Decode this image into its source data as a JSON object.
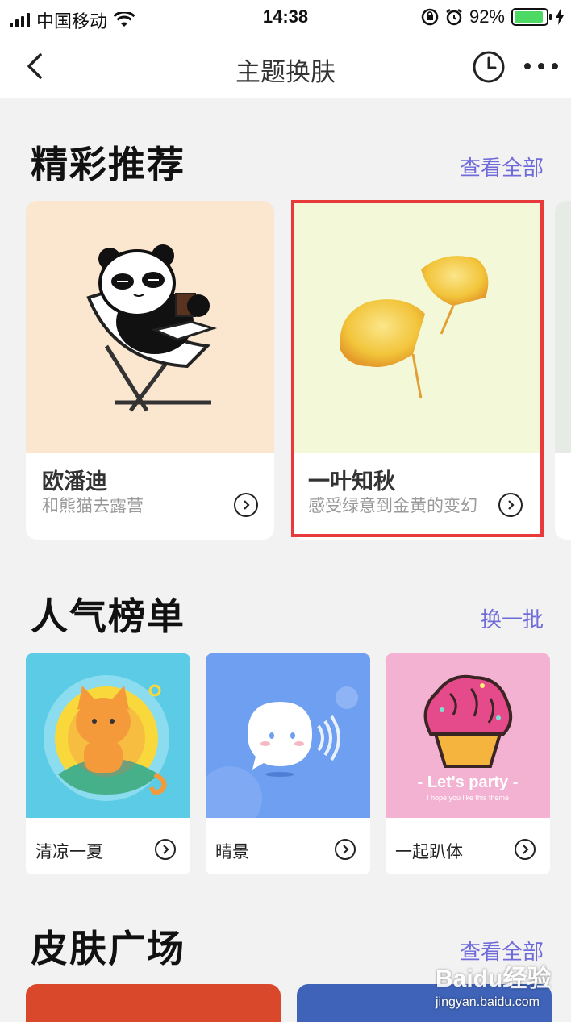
{
  "status_bar": {
    "carrier": "中国移动",
    "time": "14:38",
    "battery": "92%",
    "battery_level": 0.92
  },
  "nav": {
    "title": "主题换肤"
  },
  "featured": {
    "title": "精彩推荐",
    "view_all": "查看全部",
    "cards": [
      {
        "name": "欧潘迪",
        "desc": "和熊猫去露营"
      },
      {
        "name": "一叶知秋",
        "desc": "感受绿意到金黄的变幻"
      }
    ]
  },
  "popular": {
    "title": "人气榜单",
    "refresh": "换一批",
    "cards": [
      {
        "name": "清凉一夏"
      },
      {
        "name": "晴景"
      },
      {
        "name": "一起趴体",
        "art_title": "- Let's party -",
        "art_sub": "I hope you like this theme"
      }
    ]
  },
  "plaza": {
    "title": "皮肤广场",
    "view_all": "查看全部"
  },
  "watermark": {
    "logo": "Baidu经验",
    "url": "jingyan.baidu.com"
  },
  "colors": {
    "accent": "#6f6bd9",
    "highlight": "#e8393b",
    "card1_bg": "#fbe6cf",
    "card2_bg": "#f3f9d8"
  }
}
